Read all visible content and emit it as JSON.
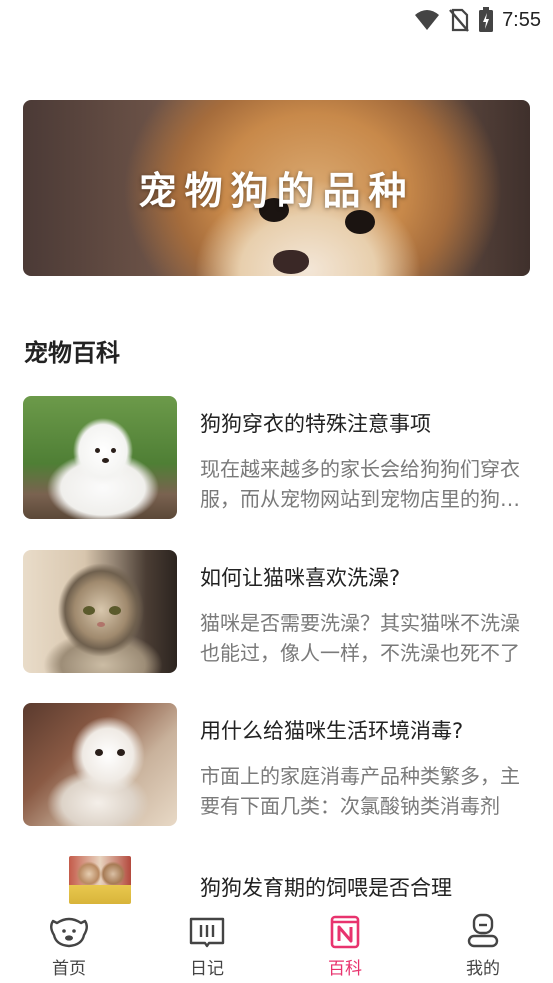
{
  "status_bar": {
    "time": "7:55"
  },
  "banner": {
    "title": "宠物狗的品种"
  },
  "section": {
    "title": "宠物百科"
  },
  "articles": [
    {
      "title": "狗狗穿衣的特殊注意事项",
      "summary": "现在越来越多的家长会给狗狗们穿衣服，而从宠物网站到宠物店里的狗狗衣服"
    },
    {
      "title": "如何让猫咪喜欢洗澡?",
      "summary": "猫咪是否需要洗澡？其实猫咪不洗澡也能过，像人一样，不洗澡也死不了"
    },
    {
      "title": "用什么给猫咪生活环境消毒?",
      "summary": "市面上的家庭消毒产品种类繁多，主要有下面几类：次氯酸钠类消毒剂"
    },
    {
      "title": "狗狗发育期的饲喂是否合理"
    }
  ],
  "nav": {
    "items": [
      {
        "label": "首页",
        "icon": "dog-face-icon"
      },
      {
        "label": "日记",
        "icon": "book-icon"
      },
      {
        "label": "百科",
        "icon": "encyclopedia-icon"
      },
      {
        "label": "我的",
        "icon": "profile-icon"
      }
    ],
    "active_index": 2,
    "active_color": "#e8336e"
  }
}
